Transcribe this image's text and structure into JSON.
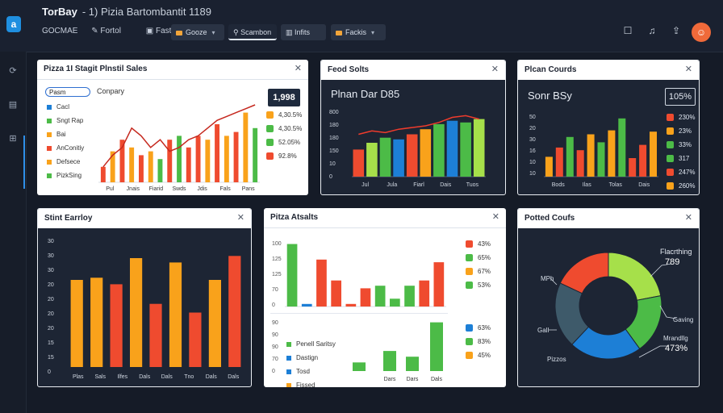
{
  "app": {
    "logo_letter": "a",
    "title": "TorBay",
    "subtitle": "- 1) Pizia Bartombantit 1189"
  },
  "nav": [
    "GOCMAE",
    "Fortol",
    "Fastos"
  ],
  "toolbar": [
    {
      "label": "Gooze",
      "icon": "square",
      "chevron": true
    },
    {
      "label": "Scambon",
      "icon": "user-icon"
    },
    {
      "label": "Infits",
      "icon": "chart-icon"
    },
    {
      "label": "Fackis",
      "icon": "square",
      "chevron": true
    }
  ],
  "header_icons": [
    "window-icon",
    "bell-icon",
    "share-icon",
    "avatar-icon"
  ],
  "sidebar_icons": [
    "refresh-icon",
    "calendar-icon",
    "grid-icon"
  ],
  "colors": {
    "red": "#ef4b2f",
    "orange": "#f9a21b",
    "green": "#4cbb47",
    "blue": "#1d7fd6",
    "lime": "#a6e04a",
    "teal": "#3ba2a8"
  },
  "panels": {
    "p1": {
      "title": "Pizza 1I Stagit Plnstil Sales",
      "header": "Conpary",
      "badge": "1,998",
      "legend": [
        {
          "label": "Pasm",
          "color": "#1d7fd6"
        },
        {
          "label": "Cacl",
          "color": "#1d7fd6"
        },
        {
          "label": "Sngt Rap",
          "color": "#4cbb47"
        },
        {
          "label": "Bai",
          "color": "#f9a21b"
        },
        {
          "label": "AnConitiy",
          "color": "#ef4b2f"
        },
        {
          "label": "Defsece",
          "color": "#f9a21b"
        },
        {
          "label": "PizkSing",
          "color": "#4cbb47"
        }
      ],
      "percents": [
        {
          "value": "4,30.5%",
          "color": "#f9a21b"
        },
        {
          "value": "4,30.5%",
          "color": "#4cbb47"
        },
        {
          "value": "52.05%",
          "color": "#4cbb47"
        },
        {
          "value": "92.8%",
          "color": "#ef4b2f"
        }
      ]
    },
    "p2": {
      "title": "Feod Solts",
      "header": "Plnan Dar D85",
      "yticks": [
        "800",
        "180",
        "180",
        "150",
        "10",
        "0"
      ]
    },
    "p3": {
      "title": "Plcan Courds",
      "header": "Sonr BSy",
      "badge": "105%",
      "yticks": [
        "50",
        "20",
        "30",
        "16",
        "10",
        "10"
      ],
      "percents": [
        {
          "value": "230%",
          "color": "#ef4b2f"
        },
        {
          "value": "23%",
          "color": "#f9a21b"
        },
        {
          "value": "33%",
          "color": "#4cbb47"
        },
        {
          "value": "317",
          "color": "#4cbb47"
        },
        {
          "value": "247%",
          "color": "#ef4b2f"
        },
        {
          "value": "260%",
          "color": "#f9a21b"
        }
      ]
    },
    "p4": {
      "title": "Stint Earrloy",
      "yticks": [
        "30",
        "30",
        "30",
        "20",
        "20",
        "20",
        "20",
        "15",
        "15",
        "0"
      ]
    },
    "p5": {
      "title": "Pitza Atsalts",
      "yticks_top": [
        "100",
        "125",
        "125",
        "70",
        "0"
      ],
      "yticks_bottom": [
        "90",
        "90",
        "90",
        "70",
        "0"
      ],
      "legend": [
        {
          "label": "Penell Saritsy",
          "color": "#4cbb47"
        },
        {
          "label": "Dastign",
          "color": "#1d7fd6"
        },
        {
          "label": "Tosd",
          "color": "#1d7fd6"
        },
        {
          "label": "Fissed",
          "color": "#f9a21b"
        }
      ],
      "percents_top": [
        {
          "value": "43%",
          "color": "#ef4b2f"
        },
        {
          "value": "65%",
          "color": "#4cbb47"
        },
        {
          "value": "67%",
          "color": "#f9a21b"
        },
        {
          "value": "53%",
          "color": "#4cbb47"
        }
      ],
      "percents_bottom": [
        {
          "value": "63%",
          "color": "#1d7fd6"
        },
        {
          "value": "83%",
          "color": "#4cbb47"
        },
        {
          "value": "45%",
          "color": "#f9a21b"
        }
      ]
    },
    "p6": {
      "title": "Potted Coufs",
      "labels": {
        "top_right": "Flacrthing",
        "top_right_value": "789",
        "left_top": "MPh",
        "left_bottom": "Gall",
        "right_mid": "Gaving",
        "right_bottom": "Mrandllg",
        "right_bottom_value": "473%",
        "bottom_left": "Pizzos"
      }
    }
  },
  "chart_data": [
    {
      "type": "bar",
      "title": "Pizza 1I Stagit Plnstil Sales",
      "categories": [
        "Pul",
        "Jnais",
        "Fiarid",
        "Swds",
        "Jdis",
        "Fals",
        "Pans"
      ],
      "series": [
        {
          "values": [
            20,
            40,
            55,
            45,
            35,
            40,
            30,
            55,
            60,
            45,
            60,
            55,
            75,
            60,
            65,
            90,
            70
          ]
        }
      ],
      "line": [
        20,
        35,
        45,
        70,
        60,
        45,
        55,
        40,
        45,
        55,
        60,
        70,
        80,
        85,
        90,
        95,
        100
      ],
      "ylim": [
        0,
        100
      ]
    },
    {
      "type": "bar",
      "title": "Feod Solts",
      "categories": [
        "Jul",
        "Jula",
        "Fiarl",
        "Dais",
        "Tuos"
      ],
      "series": [
        {
          "values": [
            80,
            100,
            115,
            110,
            125,
            140,
            155,
            165,
            160,
            170
          ]
        }
      ],
      "line": [
        125,
        135,
        130,
        140,
        145,
        150,
        160,
        175,
        180,
        170
      ],
      "ylim": [
        0,
        200
      ]
    },
    {
      "type": "bar",
      "title": "Plcan Courds",
      "categories": [
        "Bods",
        "Ilas",
        "Tolas",
        "Dais"
      ],
      "series": [
        {
          "values": [
            15,
            22,
            30,
            20,
            32,
            26,
            35,
            44,
            14,
            24,
            34
          ]
        }
      ],
      "ylim": [
        0,
        50
      ]
    },
    {
      "type": "bar",
      "title": "Stint Earrloy",
      "categories": [
        "Plas",
        "Sals",
        "Ilfes",
        "Dals",
        "Dals",
        "Tno",
        "Dals",
        "Dals"
      ],
      "series": [
        {
          "values": [
            20,
            20.5,
            19,
            25,
            14.5,
            24,
            12.5,
            20,
            25.5
          ]
        }
      ],
      "ylim": [
        0,
        30
      ]
    },
    {
      "type": "bar",
      "title": "Pitza Atsalts",
      "series": [
        {
          "values": [
            120,
            5,
            90,
            50,
            5,
            35,
            40,
            15,
            40,
            50,
            85
          ]
        }
      ],
      "ylim": [
        0,
        130
      ]
    },
    {
      "type": "bar",
      "title": "Pitza Atsalts",
      "categories": [
        "Dars",
        "Dars",
        "Dals"
      ],
      "series": [
        {
          "values": [
            15,
            35,
            25,
            85
          ]
        }
      ],
      "ylim": [
        0,
        90
      ]
    },
    {
      "type": "pie",
      "title": "Potted Coufs",
      "values": [
        22,
        18,
        22,
        20,
        18
      ],
      "colors": [
        "#a6e04a",
        "#4cbb47",
        "#1d7fd6",
        "#3e5a6a",
        "#ef4b2f"
      ]
    }
  ]
}
